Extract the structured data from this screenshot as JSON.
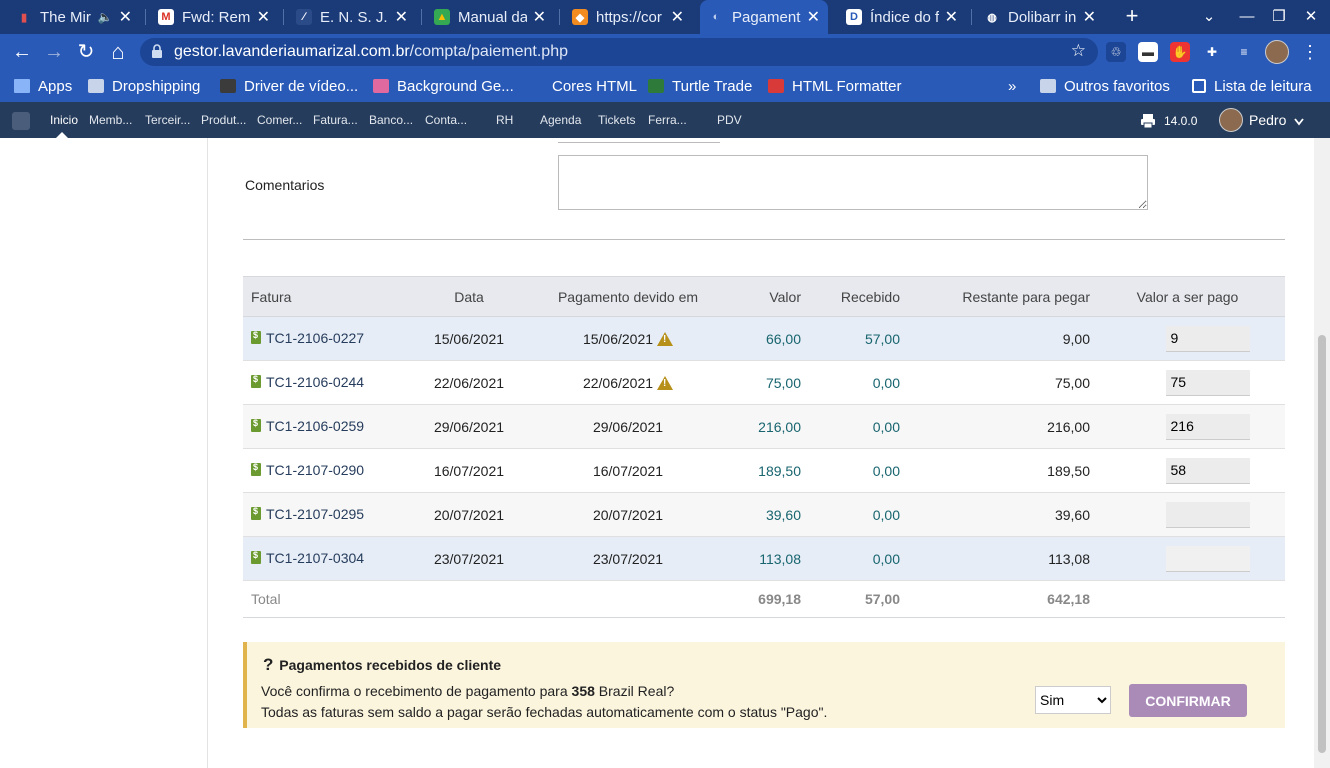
{
  "tabs": [
    {
      "title": "The Mir",
      "fav_bg": "#1a3a78",
      "fav_fg": "#e05050",
      "fav_char": "▮",
      "speaker": "🔈"
    },
    {
      "title": "Fwd: Rema",
      "fav_bg": "#ffffff",
      "fav_fg": "#d93025",
      "fav_char": "M"
    },
    {
      "title": "E. N. S. J. C",
      "fav_bg": "#2a4a88",
      "fav_fg": "#ffffff",
      "fav_char": "∕"
    },
    {
      "title": "Manual da",
      "fav_bg": "#34a853",
      "fav_fg": "#fbbc04",
      "fav_char": "▲"
    },
    {
      "title": "https://cor",
      "fav_bg": "#f28b20",
      "fav_fg": "#ffffff",
      "fav_char": "◆"
    },
    {
      "title": "Pagamento",
      "fav_bg": "#2a5ab7",
      "fav_fg": "#c0d0ee",
      "fav_char": "◐",
      "active": true
    },
    {
      "title": "Índice do f",
      "fav_bg": "#ffffff",
      "fav_fg": "#2a5ab7",
      "fav_char": "D"
    },
    {
      "title": "Dolibarr in",
      "fav_bg": "#1a3a78",
      "fav_fg": "#ffffff",
      "fav_char": "◍"
    }
  ],
  "tab_close": "✕",
  "new_tab": "+",
  "window": {
    "menu": "⌄",
    "minimize": "—",
    "restore": "❐",
    "close": "✕"
  },
  "nav": {
    "back": "←",
    "forward": "→",
    "reload": "↻",
    "home": "⌂"
  },
  "address": {
    "host": "gestor.lavanderiaumarizal.com.br",
    "path": "/compta/paiement.php",
    "star": "☆"
  },
  "extensions": [
    {
      "icon": "recycle-icon",
      "char": "♲",
      "bg": "#1c4595"
    },
    {
      "icon": "nav-extension-icon",
      "char": "▬",
      "bg": "#ffffff"
    },
    {
      "icon": "hand-blocker-icon",
      "char": "✋",
      "bg": "#e33"
    },
    {
      "icon": "puzzle-icon",
      "char": "✚",
      "bg": "#2a5ab7"
    },
    {
      "icon": "media-queue-icon",
      "char": "≡",
      "bg": "#2a5ab7"
    }
  ],
  "kebab": "⋮",
  "bookmarks": [
    {
      "label": "Apps",
      "kind": "apps",
      "color": "#8ab4f8"
    },
    {
      "label": "Dropshipping",
      "kind": "folder",
      "color": "#c8d4ea"
    },
    {
      "label": "Driver de vídeo...",
      "kind": "site",
      "color": "#3b3b3b"
    },
    {
      "label": "Background Ge...",
      "kind": "site",
      "color": "#e06aa0"
    },
    {
      "label": "Cores HTML",
      "kind": "site",
      "color": "#2a5ab7"
    },
    {
      "label": "Turtle Trade",
      "kind": "site",
      "color": "#2d7a3a"
    },
    {
      "label": "HTML Formatter",
      "kind": "site",
      "color": "#d83a3a"
    }
  ],
  "bookmarks_overflow": "»",
  "bookmarks_right": [
    {
      "label": "Outros favoritos",
      "kind": "folder"
    },
    {
      "label": "Lista de leitura",
      "kind": "reading-list"
    }
  ],
  "dolibarr_menu": [
    "Inicio",
    "Memb...",
    "Terceir...",
    "Produt...",
    "Comer...",
    "Fatura...",
    "Banco...",
    "Conta...",
    "RH",
    "Agenda",
    "Tickets",
    "Ferra...",
    "PDV"
  ],
  "dolibarr_version": "14.0.0",
  "dolibarr_user": "Pedro",
  "form": {
    "comments_label": "Comentarios",
    "comments_value": ""
  },
  "table": {
    "headers": [
      "Fatura",
      "Data",
      "Pagamento devido em",
      "Valor",
      "Recebido",
      "Restante para pegar",
      "Valor a ser pago"
    ],
    "rows": [
      {
        "ref": "TC1-2106-0227",
        "date": "15/06/2021",
        "due": "15/06/2021",
        "warn": true,
        "value": "66,00",
        "received": "57,00",
        "remaining": "9,00",
        "to_pay": "9"
      },
      {
        "ref": "TC1-2106-0244",
        "date": "22/06/2021",
        "due": "22/06/2021",
        "warn": true,
        "value": "75,00",
        "received": "0,00",
        "remaining": "75,00",
        "to_pay": "75"
      },
      {
        "ref": "TC1-2106-0259",
        "date": "29/06/2021",
        "due": "29/06/2021",
        "warn": false,
        "value": "216,00",
        "received": "0,00",
        "remaining": "216,00",
        "to_pay": "216"
      },
      {
        "ref": "TC1-2107-0290",
        "date": "16/07/2021",
        "due": "16/07/2021",
        "warn": false,
        "value": "189,50",
        "received": "0,00",
        "remaining": "189,50",
        "to_pay": "58"
      },
      {
        "ref": "TC1-2107-0295",
        "date": "20/07/2021",
        "due": "20/07/2021",
        "warn": false,
        "value": "39,60",
        "received": "0,00",
        "remaining": "39,60",
        "to_pay": ""
      },
      {
        "ref": "TC1-2107-0304",
        "date": "23/07/2021",
        "due": "23/07/2021",
        "warn": false,
        "value": "113,08",
        "received": "0,00",
        "remaining": "113,08",
        "to_pay": ""
      }
    ],
    "total": {
      "label": "Total",
      "value": "699,18",
      "received": "57,00",
      "remaining": "642,18"
    }
  },
  "confirm": {
    "title_icon": "?",
    "title": "Pagamentos recebidos de cliente",
    "line1_prefix": "Você confirma o recebimento de pagamento para ",
    "line1_amount": "358",
    "line1_suffix": " Brazil Real?",
    "line2": "Todas as faturas sem saldo a pagar serão fechadas automaticamente com o status \"Pago\".",
    "select_value": "Sim",
    "button_label": "CONFIRMAR"
  },
  "colors": {
    "tabbar": "#1a3a78",
    "chrome": "#2a5ab7",
    "dolibarr_menu": "#263c5c",
    "link": "#263c5c",
    "amount": "#18656f",
    "warning": "#b7901a",
    "confirm_bg": "#fbf5de",
    "confirm_button": "#aa8bb8"
  }
}
